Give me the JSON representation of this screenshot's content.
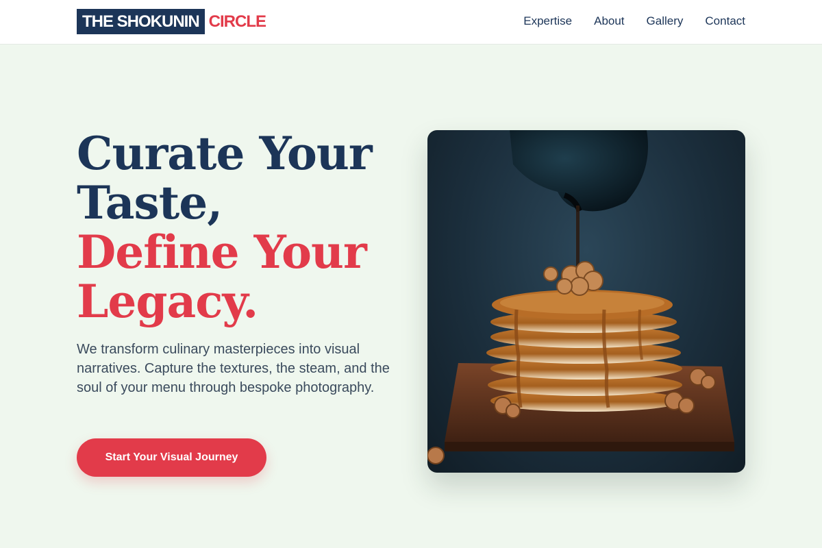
{
  "logo": {
    "main": "THE SHOKUNIN",
    "accent": "CIRCLE"
  },
  "nav": {
    "items": [
      {
        "label": "Expertise"
      },
      {
        "label": "About"
      },
      {
        "label": "Gallery"
      },
      {
        "label": "Contact"
      }
    ]
  },
  "hero": {
    "title_line1": "Curate Your",
    "title_line2": "Taste,",
    "title_line3": "Define Your",
    "title_line4": "Legacy.",
    "description": "We transform culinary masterpieces into visual narratives. Capture the textures, the steam, and the soul of your menu through bespoke photography.",
    "cta_label": "Start Your Visual Journey"
  },
  "image": {
    "subject": "stack of pancakes with walnuts and syrup being poured on a wooden board"
  },
  "colors": {
    "navy": "#1c3558",
    "accent_red": "#e23b4a",
    "background": "#eff7ee",
    "header_bg": "#ffffff"
  }
}
